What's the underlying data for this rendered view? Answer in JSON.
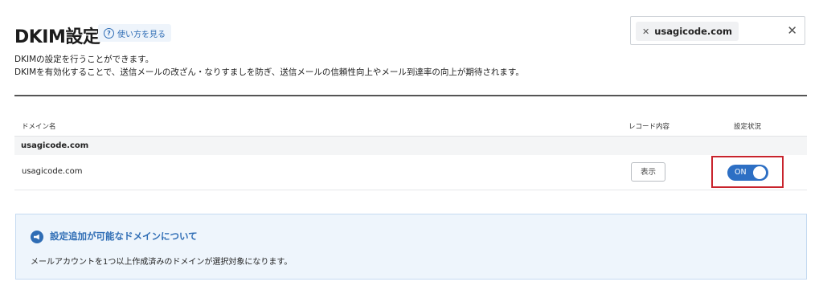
{
  "header": {
    "title": "DKIM設定",
    "help_label": "使い方を見る"
  },
  "search": {
    "chip_value": "usagicode.com"
  },
  "description": {
    "line1": "DKIMの設定を行うことができます。",
    "line2": "DKIMを有効化することで、送信メールの改ざん・なりすましを防ぎ、送信メールの信頼性向上やメール到達率の向上が期待されます。"
  },
  "table": {
    "columns": [
      "ドメイン名",
      "レコード内容",
      "設定状況"
    ],
    "group_label": "usagicode.com",
    "rows": [
      {
        "domain": "usagicode.com",
        "record_button": "表示",
        "status": "ON"
      }
    ]
  },
  "info": {
    "title": "設定追加が可能なドメインについて",
    "body": "メールアカウントを1つ以上作成済みのドメインが選択対象になります。"
  },
  "colors": {
    "accent": "#2d6fc4",
    "highlight": "#c8232c",
    "info_bg": "#eef5fc"
  },
  "icons": {
    "help": "question-circle-icon",
    "chip_remove": "close-icon",
    "clear": "close-icon",
    "info": "megaphone-icon"
  }
}
